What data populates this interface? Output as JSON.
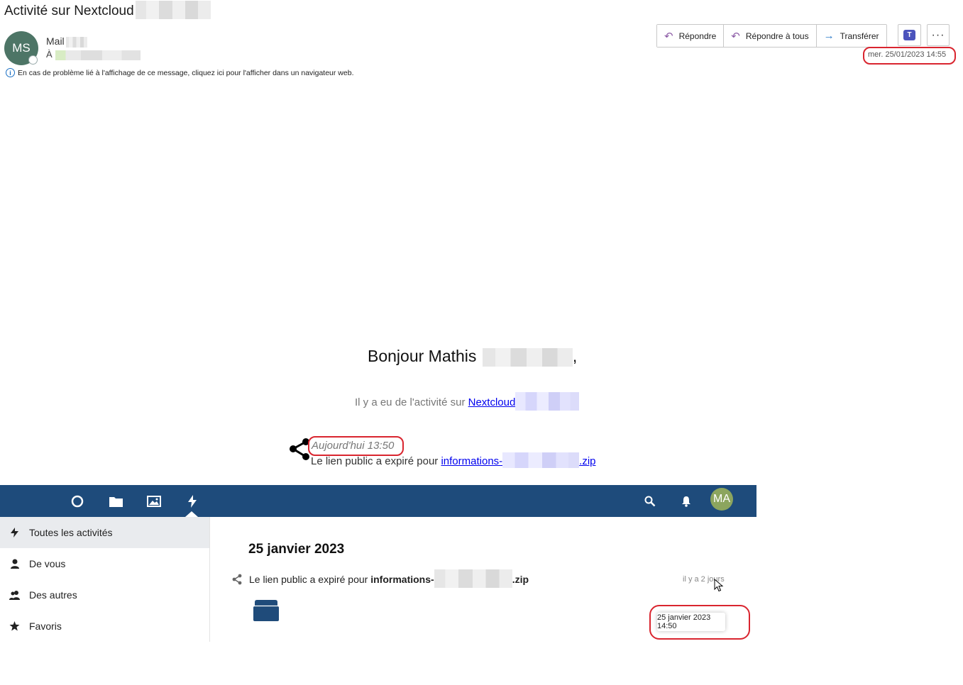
{
  "mail": {
    "subject": "Activité sur Nextcloud",
    "avatar_initials": "MS",
    "sender_label": "Mail",
    "to_label": "À",
    "info_text": "En cas de problème lié à l'affichage de ce message, cliquez ici pour l'afficher dans un navigateur web.",
    "actions": {
      "reply": "Répondre",
      "reply_all": "Répondre à tous",
      "forward": "Transférer"
    },
    "teams_icon": "T",
    "more_icon": "···",
    "date": "mer. 25/01/2023 14:55"
  },
  "email_body": {
    "greeting": "Bonjour Mathis",
    "greeting_end": ",",
    "activity_prefix": "Il y a eu de l'activité sur",
    "activity_link": "Nextcloud",
    "entry_time": "Aujourd'hui 13:50",
    "entry_text": "Le lien public a expiré pour",
    "entry_link_start": "informations-",
    "entry_link_end": ".zip"
  },
  "nextcloud": {
    "nav_icons": [
      "dashboard-icon",
      "files-icon",
      "photos-icon",
      "activity-icon"
    ],
    "header_icons": [
      "search-icon",
      "notifications-icon"
    ],
    "avatar_initials": "MA",
    "sidebar": [
      {
        "label": "Toutes les activités",
        "icon": "lightning-icon",
        "active": true
      },
      {
        "label": "De vous",
        "icon": "user-icon",
        "active": false
      },
      {
        "label": "Des autres",
        "icon": "users-icon",
        "active": false
      },
      {
        "label": "Favoris",
        "icon": "star-icon",
        "active": false
      }
    ],
    "day_heading": "25 janvier 2023",
    "entry_prefix": "Le lien public a expiré pour",
    "entry_file_start": "informations-",
    "entry_file_end": ".zip",
    "relative_time": "il y a 2 jours",
    "tooltip": "25 janvier 2023 14:50"
  },
  "colors": {
    "nextcloud_header": "#1e4b7b",
    "highlight_ring": "#d9252f",
    "avatar_ms": "#4d7566",
    "avatar_ma": "#8ca55e"
  }
}
